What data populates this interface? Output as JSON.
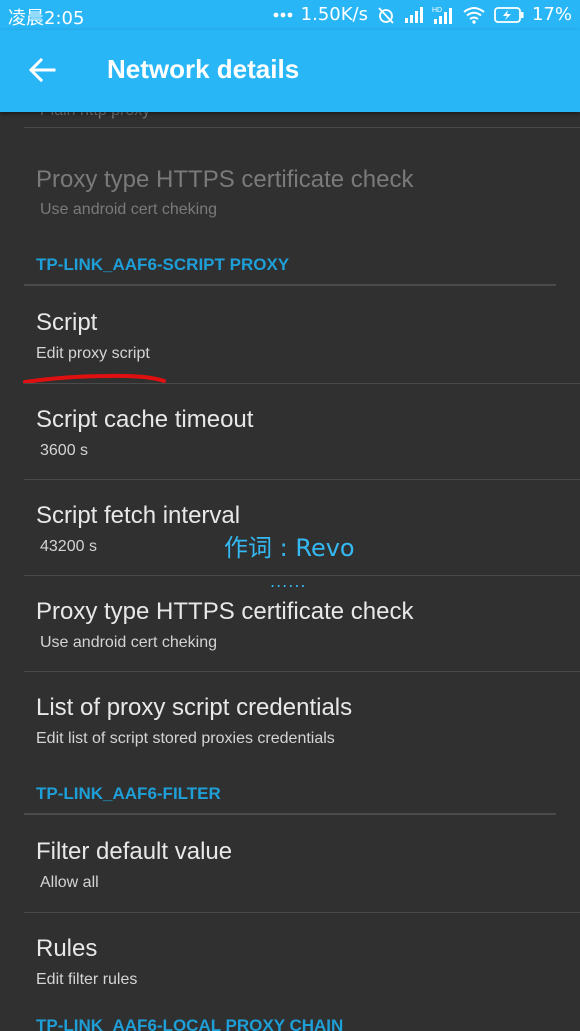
{
  "status_bar": {
    "time": "凌晨2:05",
    "network_speed": "1.50K/s",
    "battery": "17%",
    "hd_label": "HD",
    "icons": [
      "more-dots-icon",
      "alarm-off-icon",
      "signal-icon",
      "signal-hd-icon",
      "wifi-icon",
      "battery-charging-icon"
    ]
  },
  "app_bar": {
    "title": "Network details",
    "back_icon": "arrow-back-icon",
    "color": "#29b6f6"
  },
  "items": {
    "plain_proxy_sub": "Plain http proxy",
    "https_check_1": {
      "title": "Proxy type HTTPS certificate check",
      "subtitle": "Use android cert cheking"
    },
    "section_script": "TP-LINK_AAF6-SCRIPT PROXY",
    "script": {
      "title": "Script",
      "subtitle": "Edit proxy script"
    },
    "cache_timeout": {
      "title": "Script cache timeout",
      "subtitle": "3600 s"
    },
    "fetch_interval": {
      "title": "Script fetch interval",
      "subtitle": "43200 s"
    },
    "https_check_2": {
      "title": "Proxy type HTTPS certificate check",
      "subtitle": "Use android cert cheking"
    },
    "credentials": {
      "title": "List of proxy script credentials",
      "subtitle": "Edit list of script stored proxies credentials"
    },
    "section_filter": "TP-LINK_AAF6-FILTER",
    "filter_default": {
      "title": "Filter default value",
      "subtitle": "Allow all"
    },
    "rules": {
      "title": "Rules",
      "subtitle": "Edit filter rules"
    },
    "section_chain": "TP-LINK_AAF6-LOCAL PROXY CHAIN"
  },
  "overlay": {
    "lyric": "作词 : Revo",
    "dots": "......"
  },
  "colors": {
    "background": "#303030",
    "accent": "#1e9fd8",
    "annotation": "#e01010"
  }
}
